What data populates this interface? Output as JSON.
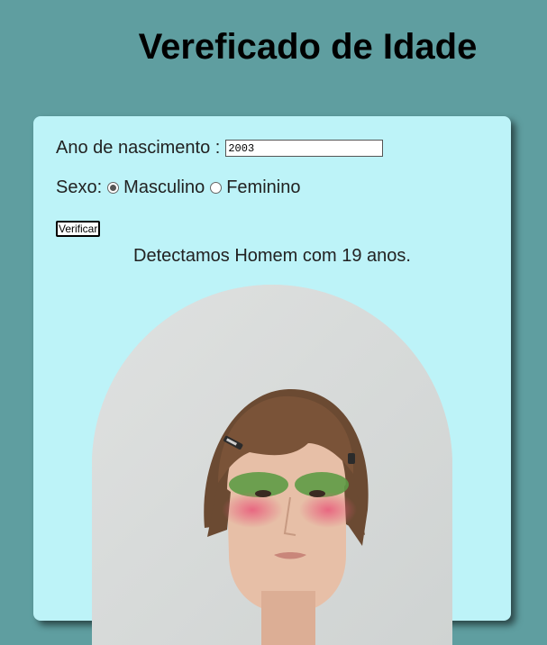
{
  "page": {
    "title": "Vereficado de Idade"
  },
  "form": {
    "year_label": "Ano de nascimento :",
    "year_value": "2003",
    "sex_label": "Sexo:",
    "options": [
      {
        "label": "Masculino",
        "checked": true
      },
      {
        "label": "Feminino",
        "checked": false
      }
    ],
    "button_label": "Verificar"
  },
  "result": {
    "text": "Detectamos Homem com 19 anos."
  },
  "photo": {
    "subject": "young man with green and pink face makeup and hair clips",
    "background_color": "#d9dcdb"
  }
}
